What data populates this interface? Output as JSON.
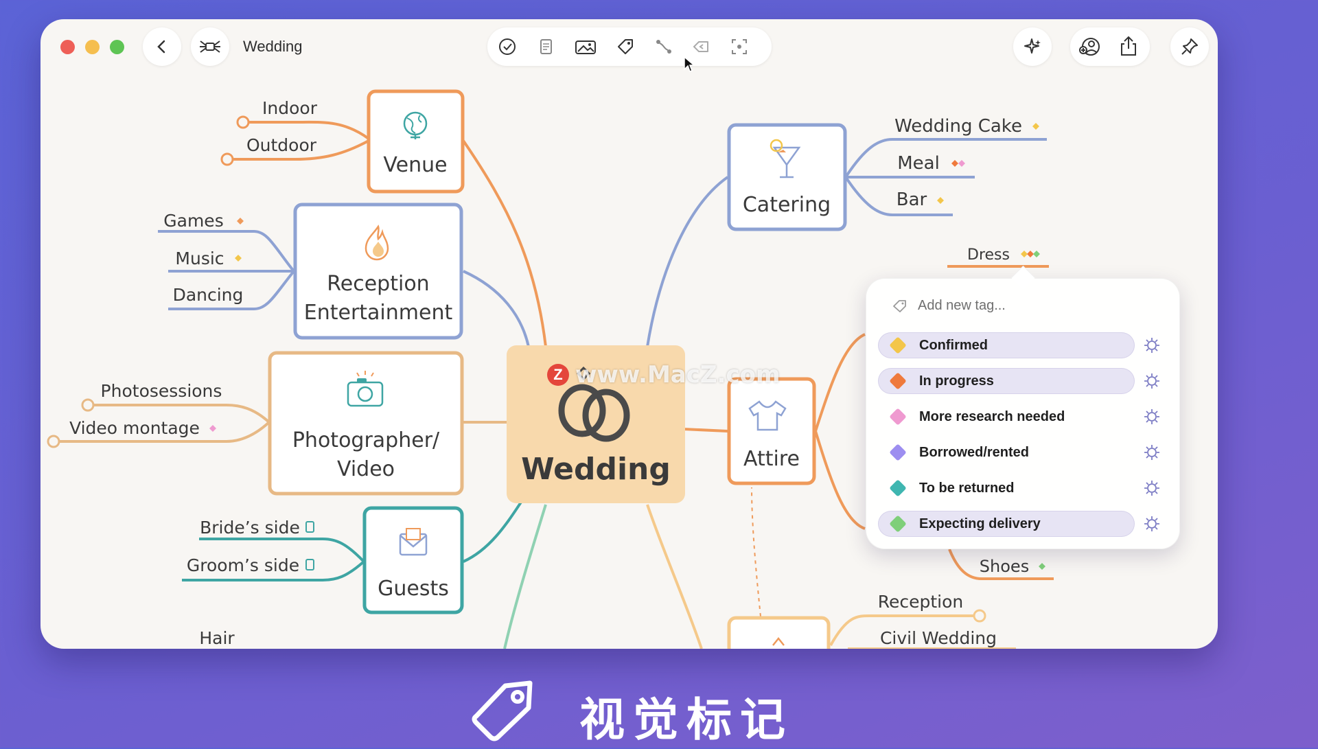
{
  "window": {
    "title": "Wedding"
  },
  "toolbar": {
    "icons": [
      "checkmark-icon",
      "note-icon",
      "image-icon",
      "tag-icon",
      "connection-icon",
      "back-link-icon",
      "focus-icon"
    ]
  },
  "right_toolbar": {
    "icons": [
      "sparkle-icon",
      "collaborate-icon",
      "share-icon",
      "pin-icon"
    ]
  },
  "mindmap": {
    "central": {
      "label": "Wedding",
      "icon": "rings-icon"
    },
    "venue": {
      "label": "Venue",
      "children": [
        "Indoor",
        "Outdoor"
      ]
    },
    "reception_entertainment": {
      "label_line1": "Reception",
      "label_line2": "Entertainment",
      "children": [
        "Games",
        "Music",
        "Dancing"
      ]
    },
    "photographer": {
      "label_line1": "Photographer/",
      "label_line2": "Video",
      "children": [
        "Photosessions",
        "Video montage"
      ]
    },
    "guests": {
      "label": "Guests",
      "children": [
        "Bride’s side",
        "Groom’s side"
      ]
    },
    "hair": "Hair",
    "catering": {
      "label": "Catering",
      "children": [
        "Wedding Cake",
        "Meal",
        "Bar"
      ]
    },
    "attire": {
      "label": "Attire",
      "children": [
        "Dress",
        "Shoes"
      ]
    },
    "ceremony_children": [
      "Reception",
      "Civil Wedding"
    ]
  },
  "tag_popover": {
    "placeholder": "Add new tag...",
    "tags": [
      {
        "label": "Confirmed",
        "color": "#f3c64a",
        "selected": true
      },
      {
        "label": "In progress",
        "color": "#ef7a3c",
        "selected": true
      },
      {
        "label": "More research needed",
        "color": "#ef9ad0",
        "selected": false
      },
      {
        "label": "Borrowed/rented",
        "color": "#9d8ef0",
        "selected": false
      },
      {
        "label": "To be returned",
        "color": "#3fb6b0",
        "selected": false
      },
      {
        "label": "Expecting delivery",
        "color": "#7fcf7a",
        "selected": true
      }
    ]
  },
  "watermark": {
    "badge": "Z",
    "text": "www.MacZ.com"
  },
  "footer": {
    "label": "视觉标记"
  },
  "colors": {
    "orange": "#ef9a5a",
    "blue": "#8ea2d3",
    "tan": "#e7b985",
    "teal": "#3ea5a3",
    "central_fill": "#f8d9ac"
  }
}
